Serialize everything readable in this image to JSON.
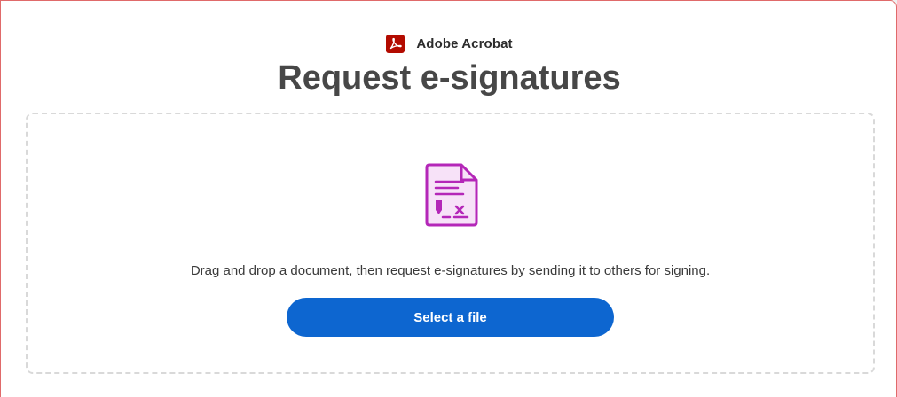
{
  "header": {
    "brand_name": "Adobe Acrobat",
    "brand_icon": "adobe-acrobat-logo",
    "brand_color": "#b30b00"
  },
  "page": {
    "title": "Request e-signatures"
  },
  "dropzone": {
    "illustration_icon": "document-signature-icon",
    "illustration_color": "#b427b8",
    "description": "Drag and drop a document, then request e-signatures by sending it to others for signing.",
    "button_label": "Select a file",
    "button_color": "#0d66d0"
  }
}
